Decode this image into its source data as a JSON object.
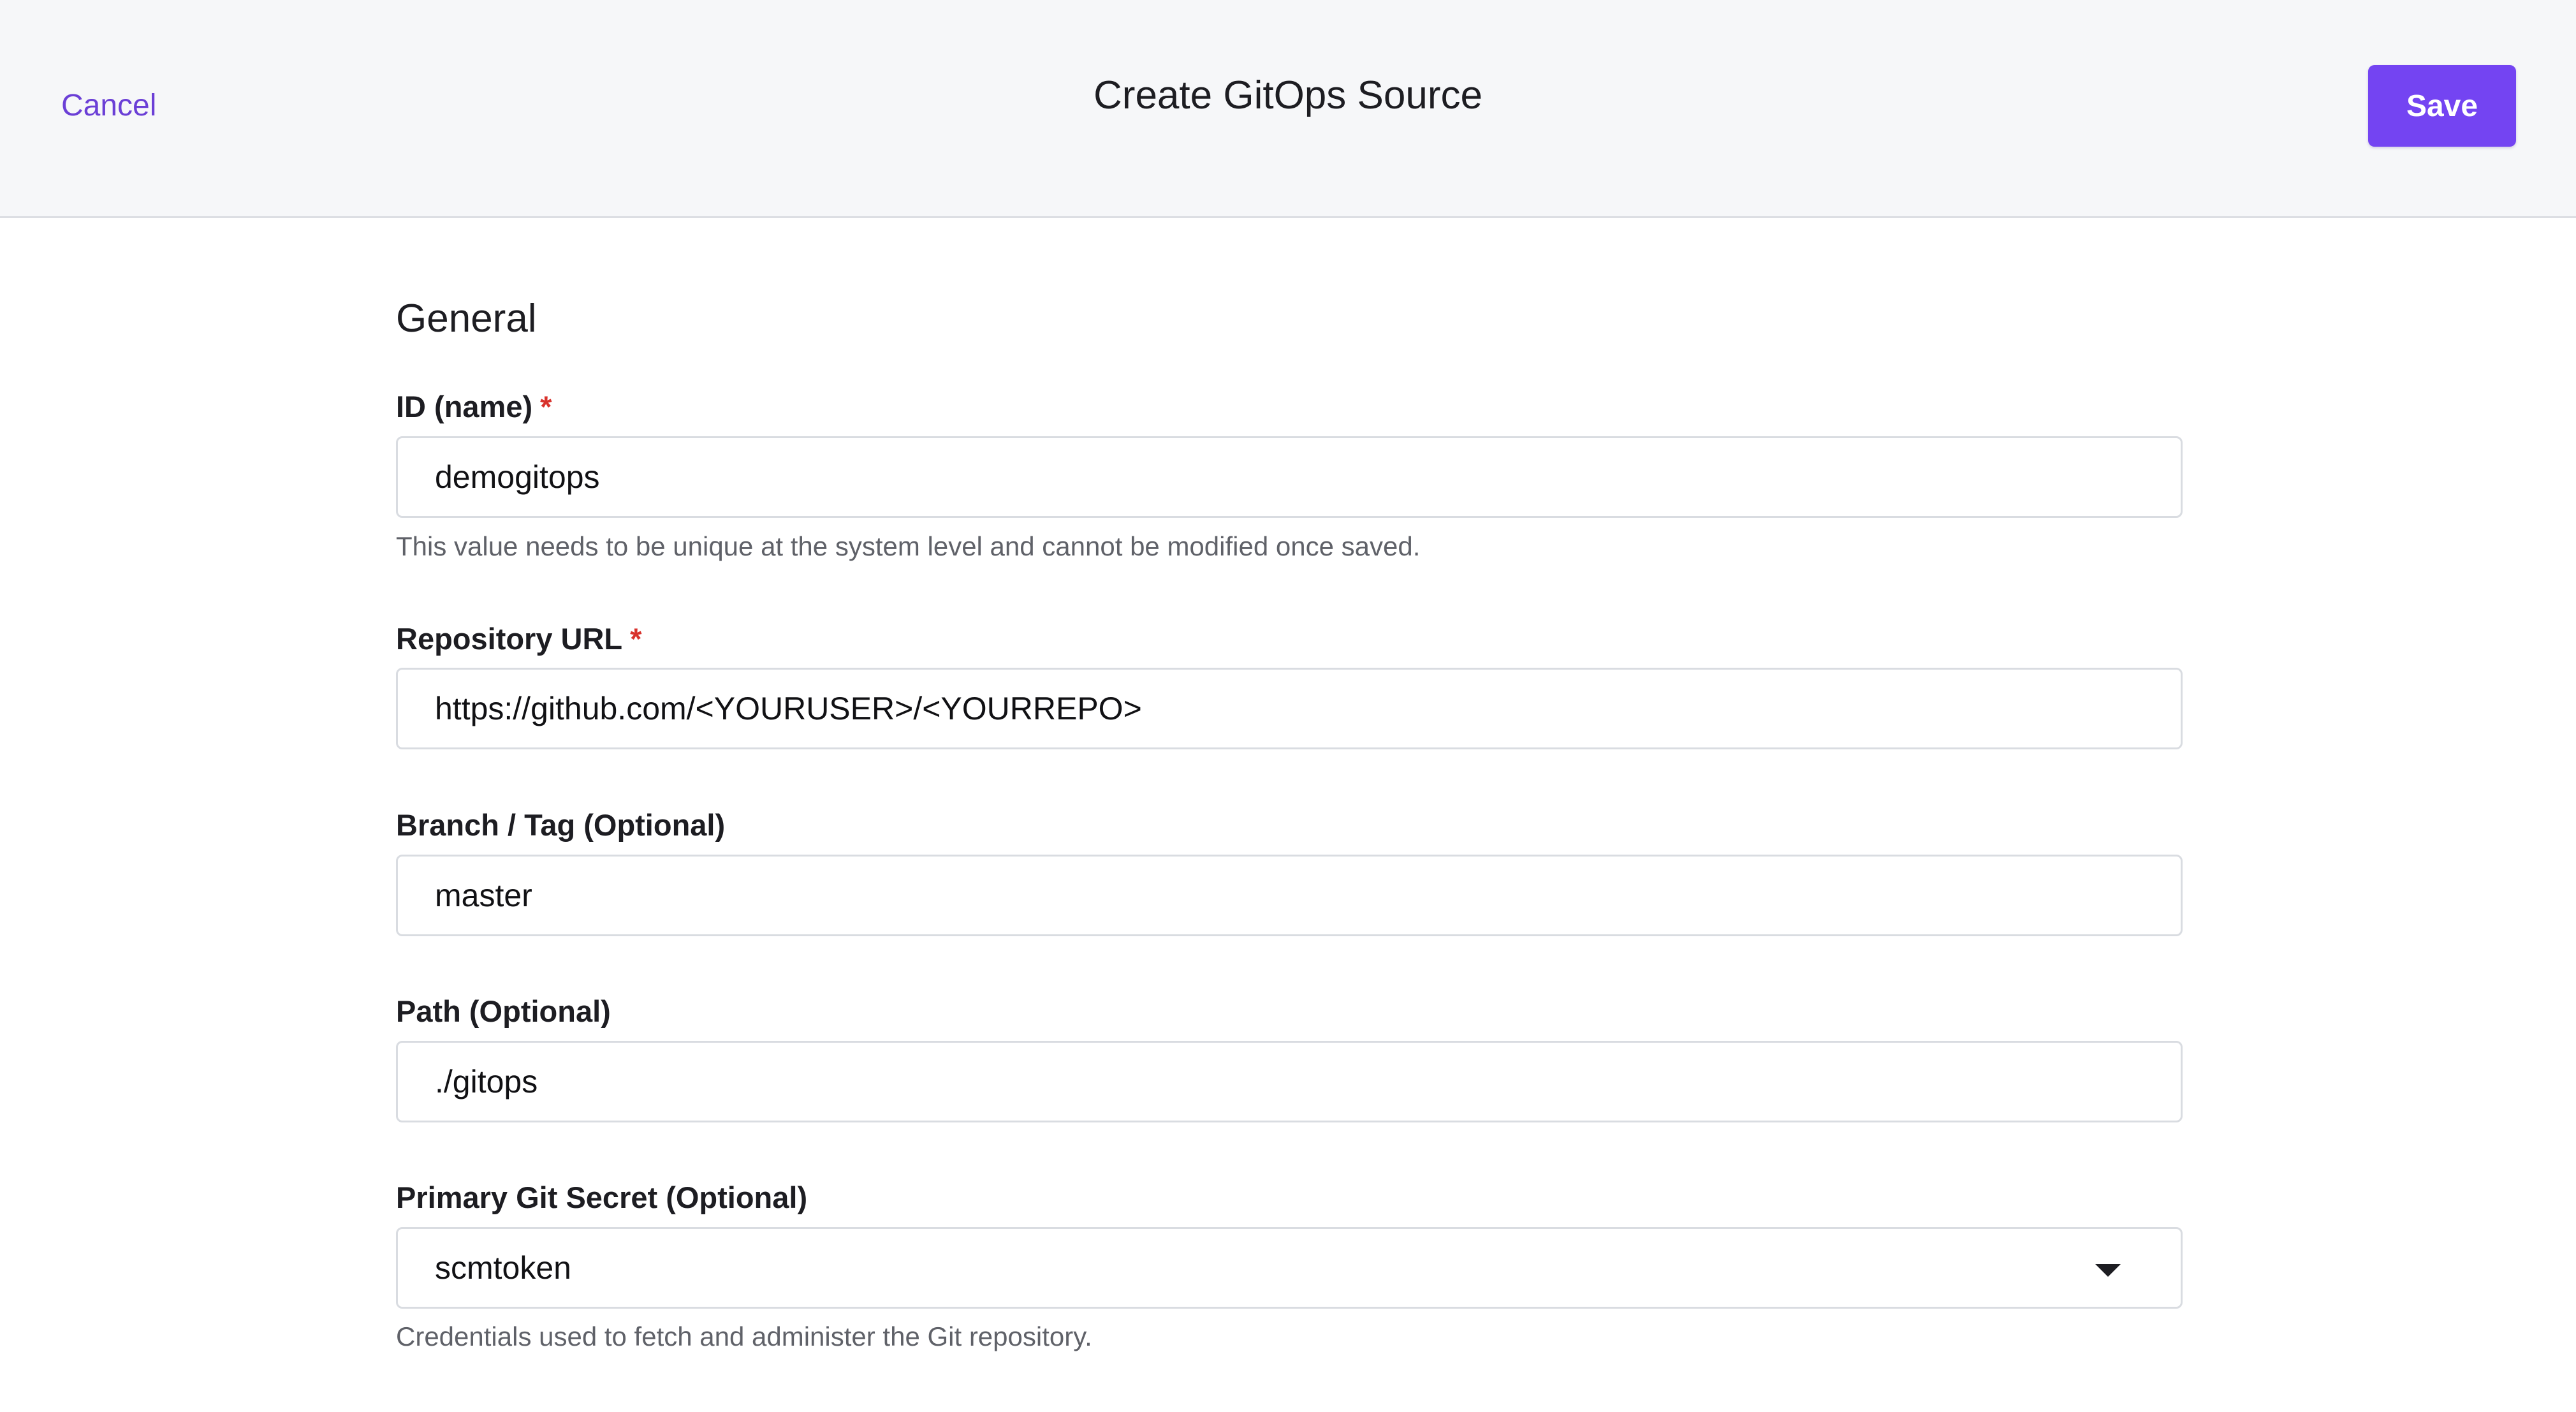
{
  "header": {
    "cancel_label": "Cancel",
    "title": "Create GitOps Source",
    "save_label": "Save"
  },
  "form": {
    "section_title": "General",
    "fields": {
      "id": {
        "label": "ID (name)",
        "required_mark": "*",
        "value": "demogitops",
        "help": "This value needs to be unique at the system level and cannot be modified once saved."
      },
      "repo_url": {
        "label": "Repository URL",
        "required_mark": "*",
        "value": "https://github.com/<YOURUSER>/<YOURREPO>"
      },
      "branch": {
        "label": "Branch / Tag (Optional)",
        "value": "master"
      },
      "path": {
        "label": "Path (Optional)",
        "value": "./gitops"
      },
      "git_secret": {
        "label": "Primary Git Secret (Optional)",
        "selected": "scmtoken",
        "help": "Credentials used to fetch and administer the Git repository."
      }
    }
  },
  "colors": {
    "accent": "#7444f2",
    "link": "#6b3fd6",
    "required": "#d8322c",
    "header_bg": "#f6f7f9"
  },
  "icons": {
    "select_caret": "chevron-down-icon"
  }
}
